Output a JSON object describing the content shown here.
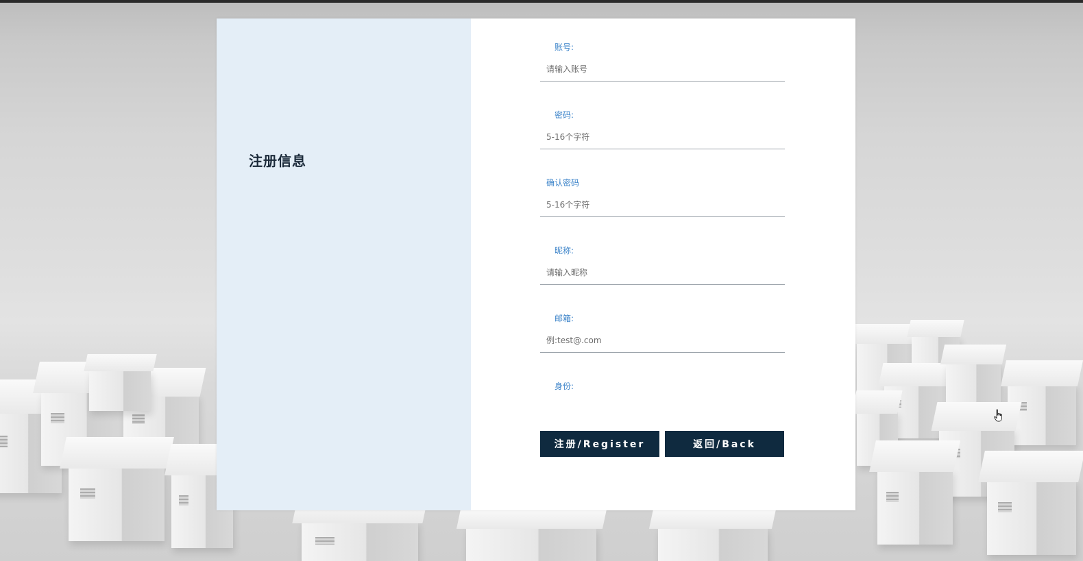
{
  "register_panel": {
    "title": "注册信息"
  },
  "form": {
    "fields": [
      {
        "label": "账号:",
        "placeholder": "请输入账号",
        "value": ""
      },
      {
        "label": "密码:",
        "placeholder": "5-16个字符",
        "value": ""
      },
      {
        "label": "确认密码",
        "placeholder": "5-16个字符",
        "value": ""
      },
      {
        "label": "昵称:",
        "placeholder": "请输入昵称",
        "value": ""
      },
      {
        "label": "邮箱:",
        "placeholder": "例:test@.com",
        "value": ""
      },
      {
        "label": "身份:"
      }
    ],
    "register_button": "注册/Register",
    "back_button": "返回/Back"
  },
  "colors": {
    "left_panel_bg": "#e4eef7",
    "label_color": "#3b83c9",
    "button_bg": "#0f2a3f"
  },
  "icons": {
    "cursor": "hand-pointer-icon"
  }
}
